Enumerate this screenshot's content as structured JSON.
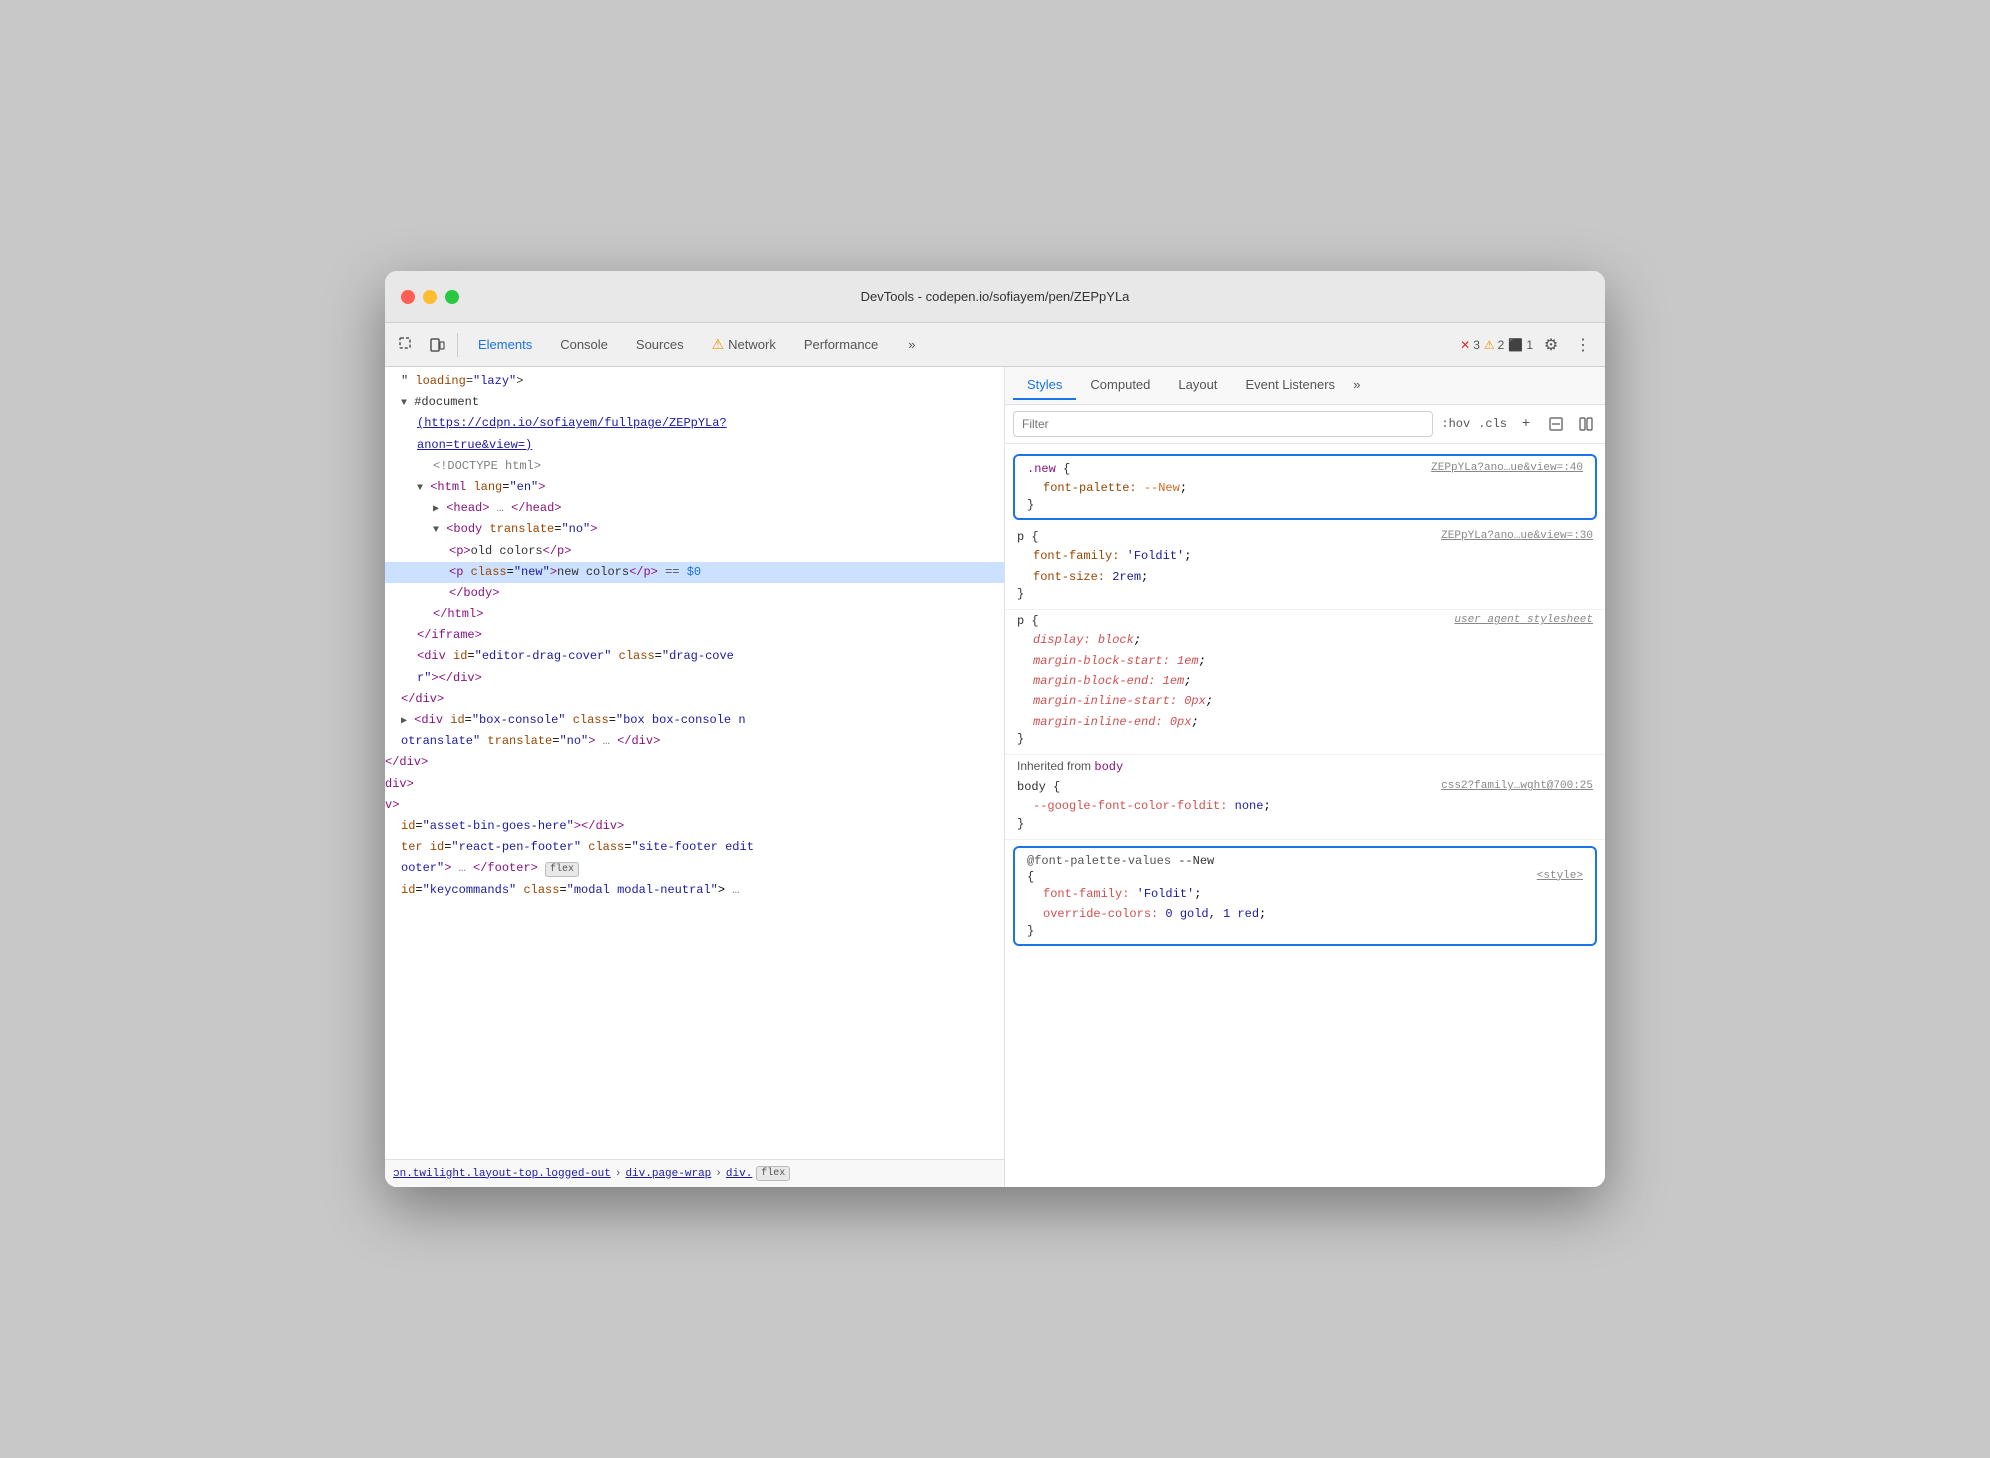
{
  "window": {
    "title": "DevTools - codepen.io/sofiayem/pen/ZEPpYLa"
  },
  "toolbar": {
    "tabs": [
      {
        "id": "elements",
        "label": "Elements",
        "active": true
      },
      {
        "id": "console",
        "label": "Console",
        "active": false
      },
      {
        "id": "sources",
        "label": "Sources",
        "active": false
      },
      {
        "id": "network",
        "label": "Network",
        "active": false,
        "warning": true
      },
      {
        "id": "performance",
        "label": "Performance",
        "active": false
      },
      {
        "id": "more",
        "label": "»",
        "active": false
      }
    ],
    "errors": "3",
    "warnings": "2",
    "info": "1"
  },
  "styles_panel": {
    "tabs": [
      "Styles",
      "Computed",
      "Layout",
      "Event Listeners",
      "»"
    ],
    "filter_placeholder": "Filter",
    "pseudo_label": ":hov",
    "cls_label": ".cls",
    "rule1": {
      "selector": ".new {",
      "close": "}",
      "source": "ZEPpYLa?ano…ue&view=:40",
      "props": [
        {
          "name": "font-palette:",
          "value": "--New",
          "color": "orange"
        }
      ]
    },
    "rule2": {
      "selector": "p {",
      "close": "}",
      "source": "ZEPpYLa?ano…ue&view=:30",
      "props": [
        {
          "name": "font-family:",
          "value": "'Foldit'",
          "color": "blue"
        },
        {
          "name": "font-size:",
          "value": "2rem",
          "color": "blue"
        }
      ]
    },
    "rule3": {
      "selector": "p {",
      "close": "}",
      "source": "user agent stylesheet",
      "props": [
        {
          "name": "display:",
          "value": "block",
          "italic": true
        },
        {
          "name": "margin-block-start:",
          "value": "1em",
          "italic": true
        },
        {
          "name": "margin-block-end:",
          "value": "1em",
          "italic": true
        },
        {
          "name": "margin-inline-start:",
          "value": "0px",
          "italic": true
        },
        {
          "name": "margin-inline-end:",
          "value": "0px",
          "italic": true
        }
      ]
    },
    "inherited_label": "Inherited from",
    "inherited_element": "body",
    "rule4": {
      "selector": "body {",
      "close": "}",
      "source": "css2?family…wght@700:25",
      "props": [
        {
          "name": "--google-font-color-foldit:",
          "value": "none",
          "color": "blue"
        }
      ]
    },
    "rule5": {
      "at_rule": "@font-palette-values --New",
      "open": "{",
      "close": "}",
      "source": "<style>",
      "props": [
        {
          "name": "font-family:",
          "value": "'Foldit'",
          "color": "blue"
        },
        {
          "name": "override-colors:",
          "value": "0 gold, 1 red",
          "color": "blue"
        }
      ]
    }
  },
  "dom_panel": {
    "lines": [
      {
        "indent": 1,
        "content": "\" loading=\"lazy\">"
      },
      {
        "indent": 1,
        "content": "▼ #document"
      },
      {
        "indent": 2,
        "content": "(https://cdpn.io/sofiayem/fullpage/ZEPpYLa?",
        "link": true
      },
      {
        "indent": 2,
        "content": "anon=true&view=)",
        "link": true
      },
      {
        "indent": 3,
        "content": "<!DOCTYPE html>"
      },
      {
        "indent": 2,
        "content": "▼ <html lang=\"en\">"
      },
      {
        "indent": 3,
        "content": "▶ <head> … </head>"
      },
      {
        "indent": 3,
        "content": "▼ <body translate=\"no\">"
      },
      {
        "indent": 4,
        "content": "<p>old colors</p>"
      },
      {
        "indent": 4,
        "content": "<p class=\"new\">new colors</p> == $0",
        "selected": true
      },
      {
        "indent": 4,
        "content": "</body>"
      },
      {
        "indent": 3,
        "content": "</html>"
      },
      {
        "indent": 2,
        "content": "</iframe>"
      },
      {
        "indent": 2,
        "content": "<div id=\"editor-drag-cover\" class=\"drag-cove"
      },
      {
        "indent": 2,
        "content": "r\"></div>"
      },
      {
        "indent": 1,
        "content": "</div>"
      },
      {
        "indent": 1,
        "content": "▶ <div id=\"box-console\" class=\"box box-console n"
      },
      {
        "indent": 1,
        "content": "otranslate\" translate=\"no\"> … </div>"
      },
      {
        "indent": 0,
        "content": "</div>"
      },
      {
        "indent": 0,
        "content": "<div>"
      },
      {
        "indent": 0,
        "content": "<v>"
      },
      {
        "indent": 1,
        "content": "id=\"asset-bin-goes-here\"></div>"
      },
      {
        "indent": 1,
        "content": "ter id=\"react-pen-footer\" class=\"site-footer edit"
      },
      {
        "indent": 1,
        "content": "ooter\"> … </footer>"
      },
      {
        "indent": 1,
        "content": "id=\"keycommands\" class=\"modal modal-neutral\"> …"
      }
    ]
  },
  "breadcrumb": {
    "items": [
      "ɔn.twilight.layout-top.logged-out",
      "div.page-wrap",
      "div."
    ],
    "flex_badge": "flex"
  }
}
